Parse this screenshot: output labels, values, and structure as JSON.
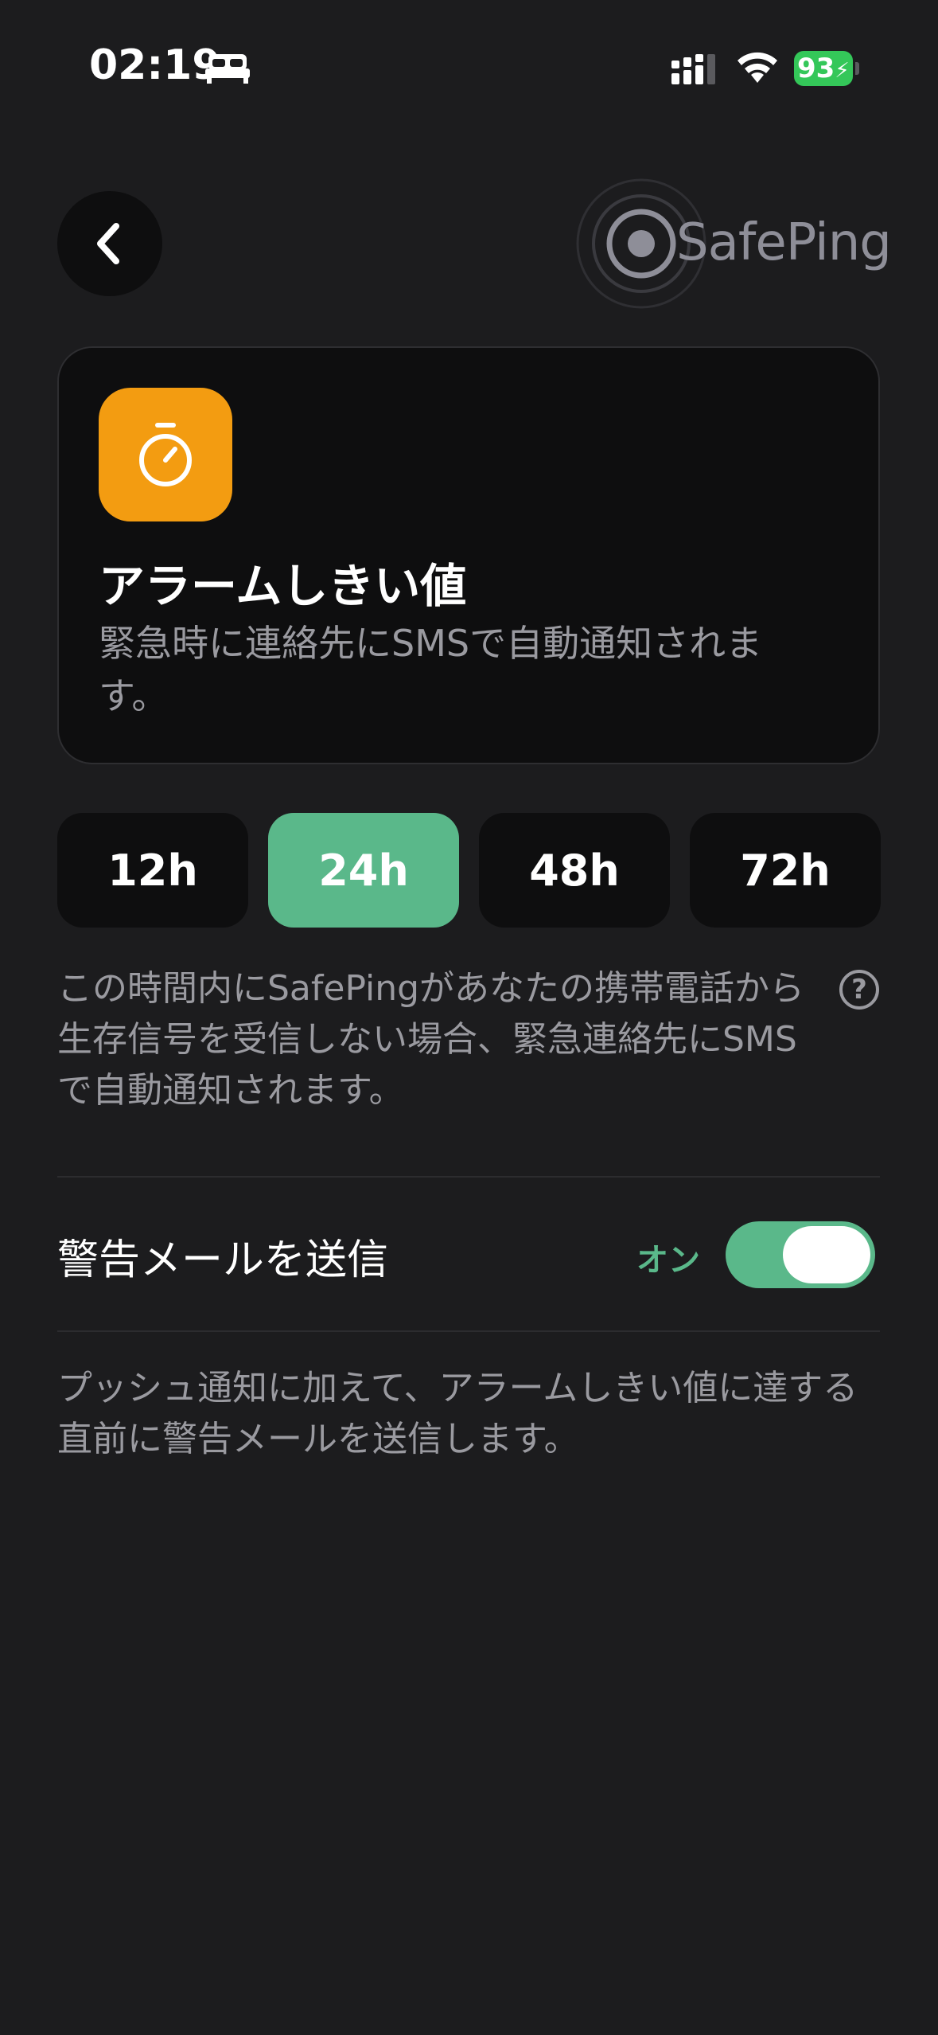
{
  "status_bar": {
    "time": "02:19",
    "battery_percent": "93",
    "icons": [
      "bed-icon",
      "signal-icon",
      "wifi-icon",
      "battery-charging-icon"
    ]
  },
  "header": {
    "back_icon": "chevron-left-icon",
    "logo_text": "SafePing"
  },
  "card": {
    "icon": "stopwatch-icon",
    "icon_color": "#f39c11",
    "title": "アラームしきい値",
    "description": "緊急時に連絡先にSMSで自動通知されます。"
  },
  "threshold_options": {
    "items": [
      {
        "label": "12h",
        "selected": false
      },
      {
        "label": "24h",
        "selected": true
      },
      {
        "label": "48h",
        "selected": false
      },
      {
        "label": "72h",
        "selected": false
      }
    ],
    "selected_color": "#5ab88a"
  },
  "explanation": {
    "text": "この時間内にSafePingがあなたの携帯電話から生存信号を受信しない場合、緊急連絡先にSMSで自動通知されます。",
    "help_icon": "question-circle-icon",
    "help_glyph": "?"
  },
  "warning_email": {
    "label": "警告メールを送信",
    "state_text": "オン",
    "enabled": true,
    "description": "プッシュ通知に加えて、アラームしきい値に達する直前に警告メールを送信します。"
  },
  "colors": {
    "background": "#1c1c1e",
    "accent_green": "#5ab88a",
    "secondary_text": "#9a9aa0"
  }
}
